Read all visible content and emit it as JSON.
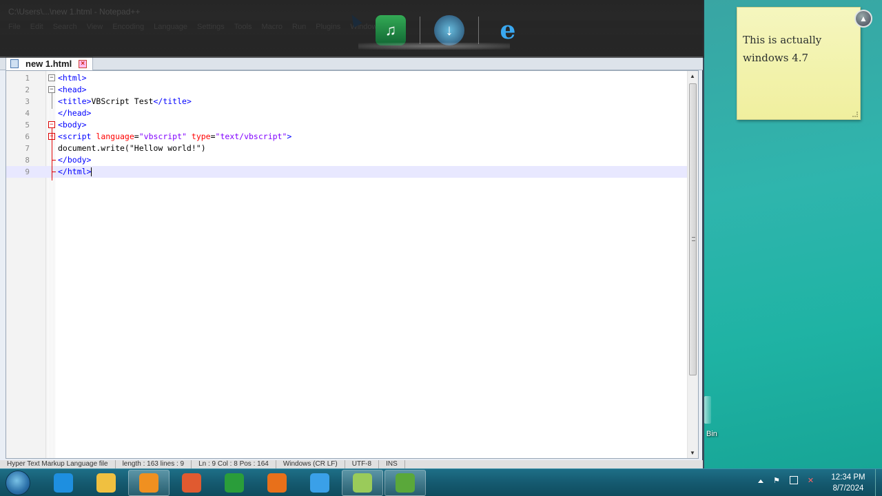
{
  "window": {
    "title": "C:\\Users\\...\\new 1.html - Notepad++",
    "menu": [
      "File",
      "Edit",
      "Search",
      "View",
      "Encoding",
      "Language",
      "Settings",
      "Tools",
      "Macro",
      "Run",
      "Plugins",
      "Window",
      "?"
    ]
  },
  "tab": {
    "label": "new 1.html",
    "close_icon": "close-x-icon"
  },
  "code": {
    "lines": [
      {
        "no": "1",
        "parts": [
          {
            "t": "<html>",
            "c": "tag"
          }
        ]
      },
      {
        "no": "2",
        "parts": [
          {
            "t": "<head>",
            "c": "tag"
          }
        ]
      },
      {
        "no": "3",
        "parts": [
          {
            "t": "<title>",
            "c": "tag"
          },
          {
            "t": "VBScript Test",
            "c": "txt"
          },
          {
            "t": "</title>",
            "c": "tag"
          }
        ]
      },
      {
        "no": "4",
        "parts": [
          {
            "t": "</head>",
            "c": "tag"
          }
        ]
      },
      {
        "no": "5",
        "parts": [
          {
            "t": "<body>",
            "c": "tag"
          }
        ]
      },
      {
        "no": "6",
        "parts": [
          {
            "t": "<script ",
            "c": "tag"
          },
          {
            "t": "language",
            "c": "attr"
          },
          {
            "t": "=",
            "c": "txt"
          },
          {
            "t": "\"vbscript\"",
            "c": "str"
          },
          {
            "t": " ",
            "c": "txt"
          },
          {
            "t": "type",
            "c": "attr"
          },
          {
            "t": "=",
            "c": "txt"
          },
          {
            "t": "\"text/vbscript\"",
            "c": "str"
          },
          {
            "t": ">",
            "c": "tag"
          }
        ]
      },
      {
        "no": "7",
        "parts": [
          {
            "t": "document.write(\"Hellow world!\")",
            "c": "txt"
          }
        ]
      },
      {
        "no": "8",
        "parts": [
          {
            "t": "</body>",
            "c": "tag"
          }
        ]
      },
      {
        "no": "9",
        "parts": [
          {
            "t": "</html>",
            "c": "tag"
          }
        ]
      }
    ],
    "current_line": 9
  },
  "status_bar": {
    "type": "Hyper Text Markup Language file",
    "length": "length : 163   lines : 9",
    "position": "Ln : 9   Col : 8   Pos : 164",
    "eol": "Windows (CR LF)",
    "encoding": "UTF-8",
    "mode": "INS"
  },
  "dock": {
    "icons": [
      "music-converter-icon",
      "globe-download-icon",
      "internet-explorer-icon"
    ]
  },
  "sticky_note": {
    "text": "This is actually windows 4.7"
  },
  "desktop": {
    "recycle_label": "Bin"
  },
  "taskbar": {
    "apps": [
      {
        "name": "internet-explorer-icon",
        "color": "#1e8fe0"
      },
      {
        "name": "file-explorer-icon",
        "color": "#f0c040"
      },
      {
        "name": "media-player-icon",
        "color": "#f09020",
        "active": true
      },
      {
        "name": "paint-app-icon",
        "color": "#e05a30"
      },
      {
        "name": "chrome-icon",
        "color": "#2a9d3a"
      },
      {
        "name": "firefox-icon",
        "color": "#e8701a"
      },
      {
        "name": "bird-app-icon",
        "color": "#3aa0e8"
      },
      {
        "name": "folder-app-icon",
        "color": "#9acb5a",
        "active": true
      },
      {
        "name": "notepadpp-icon",
        "color": "#5aa83a",
        "active": true
      }
    ],
    "clock_time": "12:34 PM",
    "clock_date": "8/7/2024"
  },
  "colors": {
    "tag": "#0000ff",
    "attr": "#ff0000",
    "string": "#8000ff",
    "current_line": "#e8e8ff"
  }
}
